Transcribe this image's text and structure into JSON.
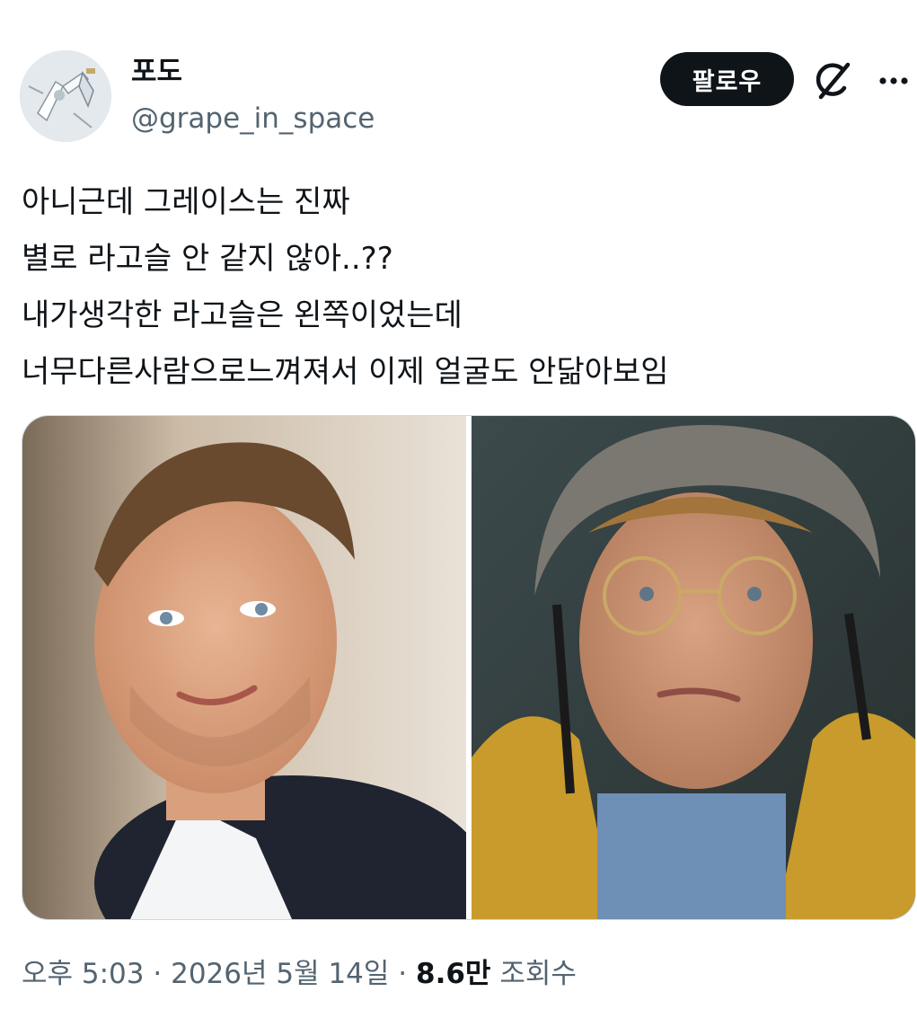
{
  "author": {
    "display_name": "포도",
    "handle": "@grape_in_space"
  },
  "actions": {
    "follow_label": "팔로우",
    "grok_icon": "grok-icon",
    "more_icon": "more-icon"
  },
  "tweet": {
    "lines": [
      "아니근데 그레이스는 진짜",
      "별로 라고슬 안 같지 않아..??",
      "내가생각한 라고슬은 왼쪽이었는데",
      "너무다른사람으로느껴져서 이제 얼굴도 안닮아보임"
    ]
  },
  "media": {
    "count": 2
  },
  "meta": {
    "time": "오후 5:03",
    "separator": "·",
    "date": "2026년 5월 14일",
    "views_count": "8.6만",
    "views_label": "조회수"
  },
  "colors": {
    "text_primary": "#0f1419",
    "text_secondary": "#536471",
    "button_bg": "#0f1419",
    "button_text": "#ffffff",
    "border": "#cfd9de"
  }
}
